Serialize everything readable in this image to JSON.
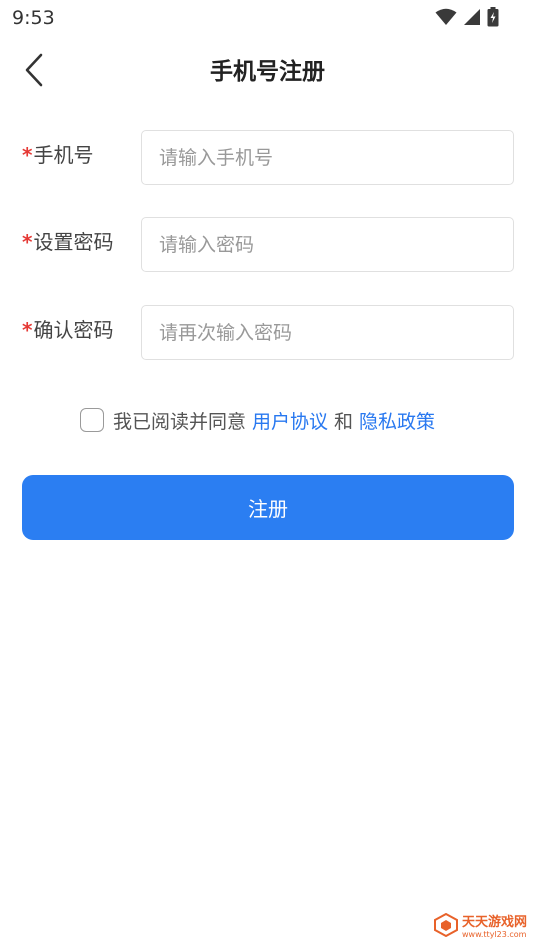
{
  "status_bar": {
    "time": "9:53",
    "icons": [
      "wifi-icon",
      "signal-icon",
      "battery-icon"
    ]
  },
  "header": {
    "title": "手机号注册",
    "back_icon": "chevron-left-icon"
  },
  "form": {
    "required_mark": "*",
    "fields": [
      {
        "label": "手机号",
        "placeholder": "请输入手机号",
        "value": ""
      },
      {
        "label": "设置密码",
        "placeholder": "请输入密码",
        "value": ""
      },
      {
        "label": "确认密码",
        "placeholder": "请再次输入密码",
        "value": ""
      }
    ]
  },
  "agreement": {
    "checked": false,
    "text": "我已阅读并同意",
    "user_agreement": "用户协议",
    "and": "和",
    "privacy_policy": "隐私政策"
  },
  "register_button": {
    "label": "注册"
  },
  "watermark": {
    "name": "天天游戏网",
    "url": "www.ttyl23.com"
  },
  "colors": {
    "primary": "#2b7ef2",
    "link": "#2878f0",
    "required": "#e53935",
    "watermark": "#e8622a"
  }
}
